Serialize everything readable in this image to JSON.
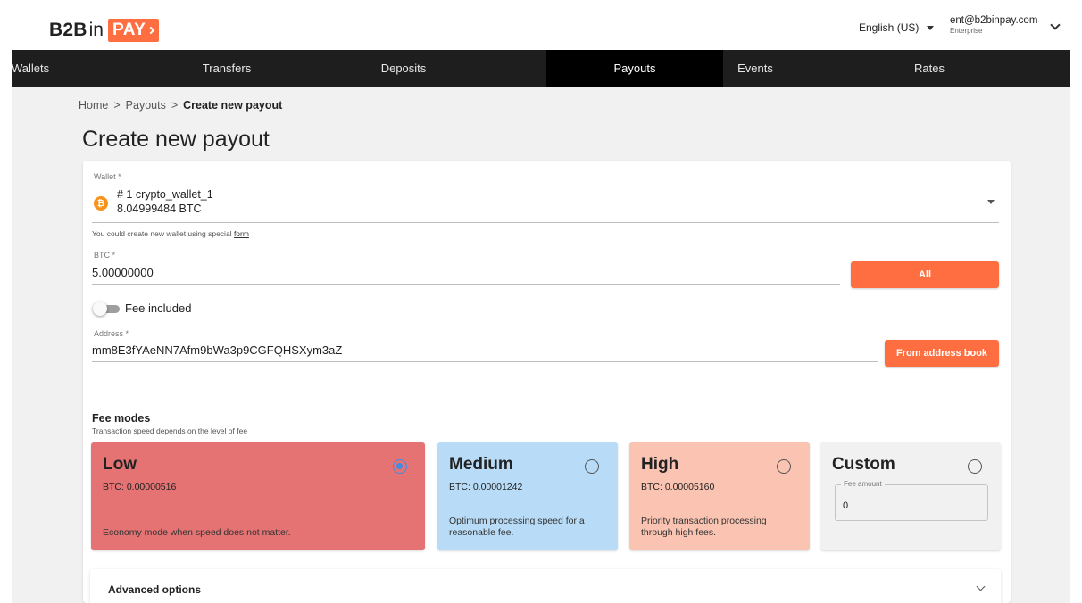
{
  "header": {
    "logo_b2b": "B2B",
    "logo_in": "in",
    "logo_pay": "PAY",
    "language": "English (US)",
    "user_email": "ent@b2binpay.com",
    "user_role": "Enterprise"
  },
  "nav": {
    "items": [
      {
        "label": "Wallets"
      },
      {
        "label": "Transfers"
      },
      {
        "label": "Deposits"
      },
      {
        "label": "Payouts"
      },
      {
        "label": "Events"
      },
      {
        "label": "Rates"
      }
    ],
    "active": "Payouts"
  },
  "breadcrumb": {
    "home": "Home",
    "payouts": "Payouts",
    "current": "Create new payout",
    "separator": ">"
  },
  "page": {
    "title": "Create new payout"
  },
  "form": {
    "wallet": {
      "label": "Wallet *",
      "name": "# 1 crypto_wallet_1",
      "balance": "8.04999484 BTC",
      "icon_glyph": "₿",
      "hint_prefix": "You could create new wallet using special",
      "hint_link": "form"
    },
    "amount": {
      "label": "BTC *",
      "value": "5.00000000",
      "all_button": "All"
    },
    "fee_included": {
      "label": "Fee included",
      "checked": false
    },
    "address": {
      "label": "Address *",
      "value": "mm8E3fYAeNN7Afm9bWa3p9CGFQHSXym3aZ",
      "address_book_button": "From address book"
    },
    "fee_modes": {
      "title": "Fee modes",
      "subtitle": "Transaction speed depends on the level of fee",
      "selected": "Low",
      "modes": [
        {
          "name": "Low",
          "rate": "BTC: 0.00000516",
          "description": "Economy mode when speed does not matter.",
          "color": "#e57373"
        },
        {
          "name": "Medium",
          "rate": "BTC: 0.00001242",
          "description_1": "Optimum processing speed for a",
          "description_2": "reasonable fee.",
          "color": "#b8dcf7"
        },
        {
          "name": "High",
          "rate": "BTC: 0.00005160",
          "description_1": "Priority transaction processing",
          "description_2": "through high fees.",
          "color": "#fbc3b1"
        },
        {
          "name": "Custom",
          "fee_amount_label": "Fee amount",
          "fee_amount_value": "0",
          "color": "#f1f1f1"
        }
      ]
    },
    "advanced": {
      "label": "Advanced options"
    }
  },
  "colors": {
    "accent": "#ff6e40",
    "nav_bg": "#1e1e1e",
    "nav_active": "#000000",
    "radio_checked": "#3f8be6"
  }
}
